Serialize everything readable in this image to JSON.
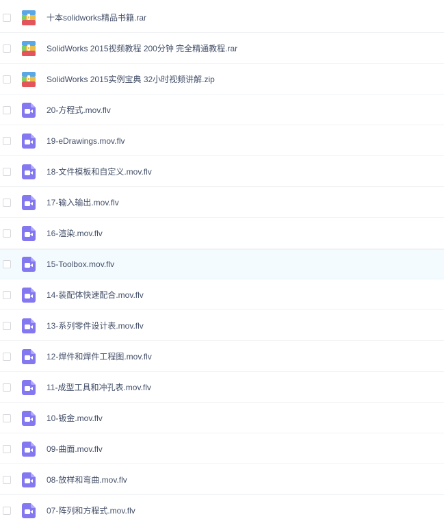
{
  "colors": {
    "archive_top": "#5aa7e6",
    "archive_middle": "#e9c14a",
    "archive_bottom": "#e2555a",
    "archive_band_left": "#7ccf6a",
    "video_icon": "#8378ef",
    "hover_row": "#f4fbff",
    "file_name_text": "#424e67"
  },
  "files": [
    {
      "name": "十本solidworks精品书籍.rar",
      "icon": "archive-icon"
    },
    {
      "name": "SolidWorks 2015视频教程 200分钟 完全精通教程.rar",
      "icon": "archive-icon"
    },
    {
      "name": "SolidWorks 2015实例宝典 32小时视频讲解.zip",
      "icon": "archive-icon"
    },
    {
      "name": "20-方程式.mov.flv",
      "icon": "video-icon"
    },
    {
      "name": "19-eDrawings.mov.flv",
      "icon": "video-icon"
    },
    {
      "name": "18-文件模板和自定义.mov.flv",
      "icon": "video-icon"
    },
    {
      "name": "17-输入输出.mov.flv",
      "icon": "video-icon"
    },
    {
      "name": "16-渲染.mov.flv",
      "icon": "video-icon"
    },
    {
      "name": "15-Toolbox.mov.flv",
      "icon": "video-icon",
      "hover": true
    },
    {
      "name": "14-装配体快速配合.mov.flv",
      "icon": "video-icon"
    },
    {
      "name": "13-系列零件设计表.mov.flv",
      "icon": "video-icon"
    },
    {
      "name": "12-焊件和焊件工程图.mov.flv",
      "icon": "video-icon"
    },
    {
      "name": "11-成型工具和冲孔表.mov.flv",
      "icon": "video-icon"
    },
    {
      "name": "10-钣金.mov.flv",
      "icon": "video-icon"
    },
    {
      "name": "09-曲面.mov.flv",
      "icon": "video-icon"
    },
    {
      "name": "08-放样和弯曲.mov.flv",
      "icon": "video-icon"
    },
    {
      "name": "07-阵列和方程式.mov.flv",
      "icon": "video-icon"
    }
  ]
}
